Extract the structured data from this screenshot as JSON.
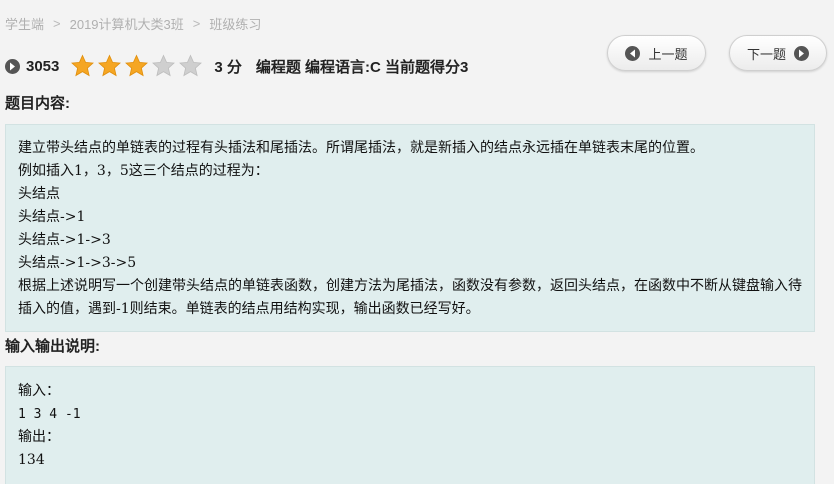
{
  "breadcrumb": {
    "items": [
      "学生端",
      "2019计算机大类3班",
      "班级练习"
    ],
    "separator": ">"
  },
  "question": {
    "id": "3053",
    "stars_filled": 3,
    "stars_total": 5,
    "score": "3 分",
    "meta": "编程题 编程语言:C 当前题得分3"
  },
  "nav": {
    "prev_label": "上一题",
    "next_label": "下一题"
  },
  "sections": {
    "content_title": "题目内容:",
    "io_title": "输入输出说明:"
  },
  "content": {
    "lines": [
      "建立带头结点的单链表的过程有头插法和尾插法。所谓尾插法，就是新插入的结点永远插在单链表末尾的位置。",
      "例如插入1，3，5这三个结点的过程为：",
      "头结点",
      "头结点->1",
      "头结点->1->3",
      "头结点->1->3->5",
      "根据上述说明写一个创建带头结点的单链表函数，创建方法为尾插法，函数没有参数，返回头结点，在函数中不断从键盘输入待插入的值，遇到-1则结束。单链表的结点用结构实现，输出函数已经写好。"
    ]
  },
  "io": {
    "input_label": "输入：",
    "input_value": "1 3 4 -1",
    "output_label": "输出：",
    "output_value": "134"
  },
  "colors": {
    "star_filled": "#f5a623",
    "star_empty": "#cfcfcf",
    "box_bg": "#e0eeee",
    "icon_dark": "#555555"
  }
}
